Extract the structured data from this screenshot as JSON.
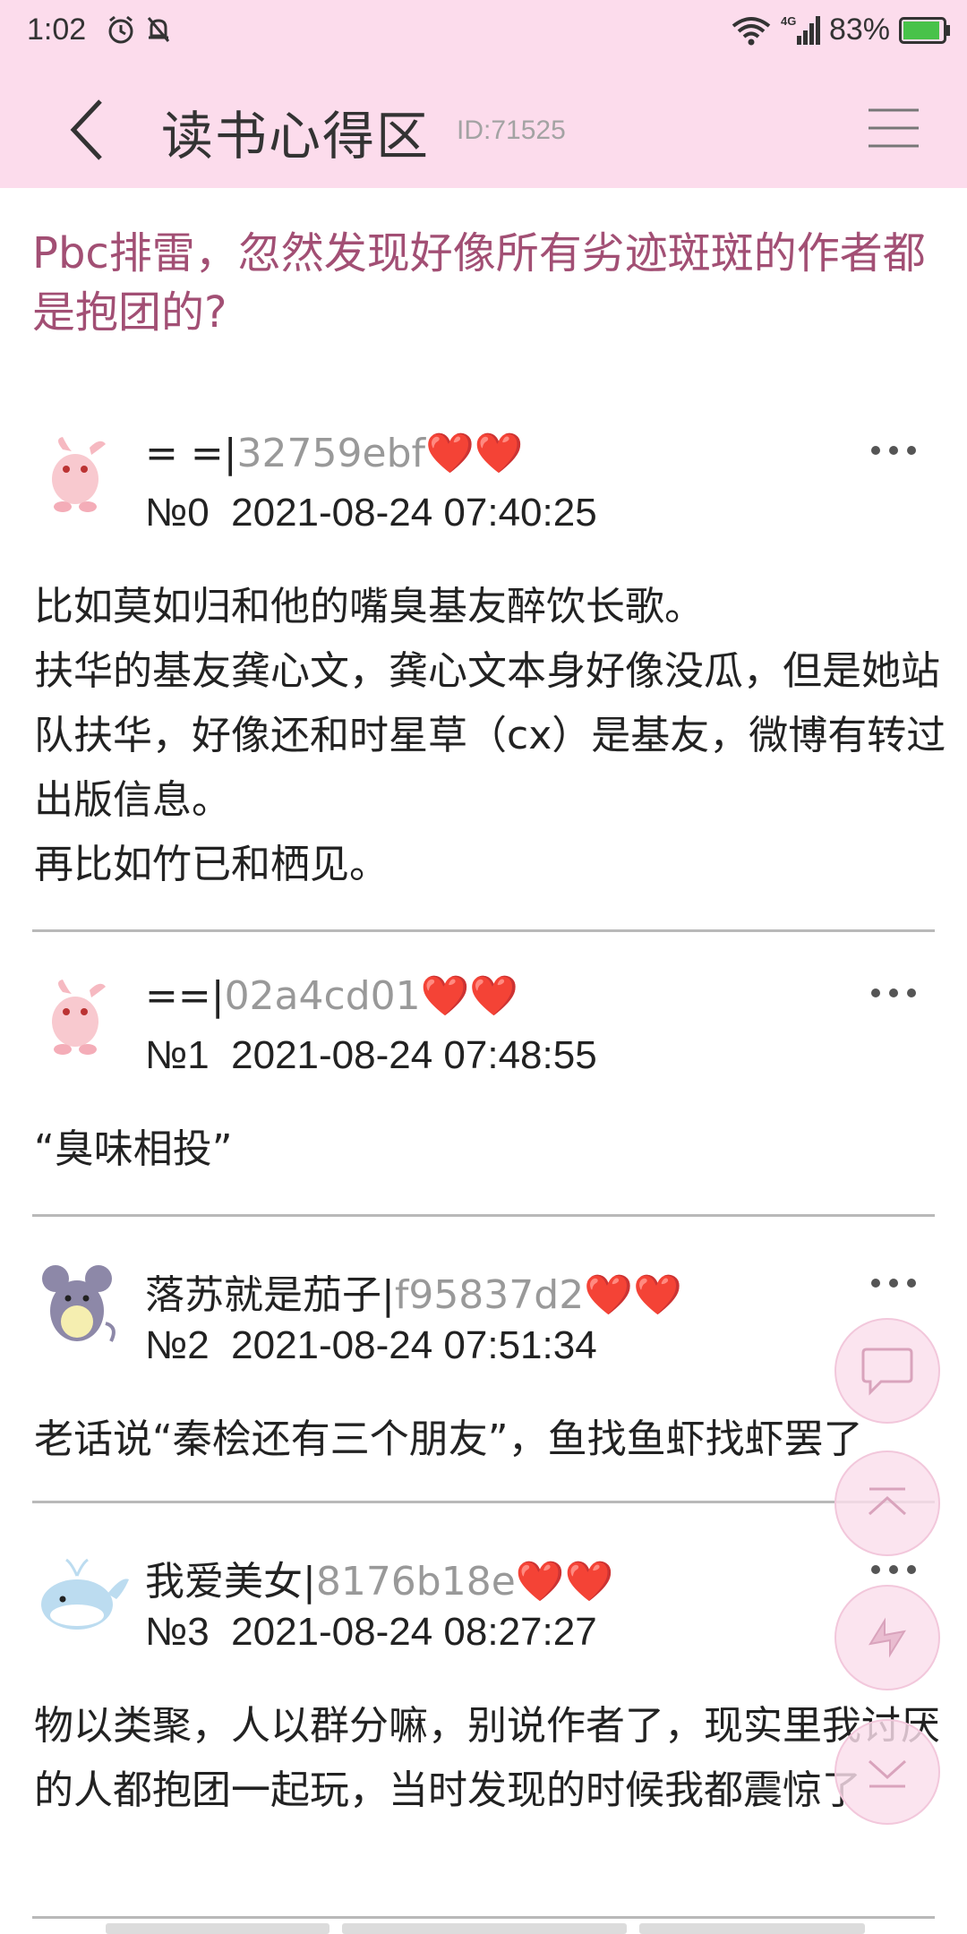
{
  "status_bar": {
    "time": "1:02",
    "network": "4G",
    "battery": "83%",
    "icons": [
      "alarm-icon",
      "mute-icon",
      "wifi-icon",
      "signal-icon",
      "battery-icon"
    ]
  },
  "header": {
    "title": "读书心得区",
    "id_label": "ID:71525",
    "back_icon": "chevron-left-icon",
    "menu_icon": "hamburger-menu-icon"
  },
  "thread": {
    "title": "Pbc排雷，忽然发现好像所有劣迹斑斑的作者都是抱团的?"
  },
  "posts": [
    {
      "user_name": "= =|",
      "user_hash": "32759ebf",
      "hearts": "❤️❤️",
      "floor": "№0",
      "timestamp": "2021-08-24 07:40:25",
      "body": "比如莫如归和他的嘴臭基友醉饮长歌。\n扶华的基友龚心文，龚心文本身好像没瓜，但是她站队扶华，好像还和时星草（cx）是基友，微博有转过出版信息。\n再比如竹已和栖见。",
      "avatar": "pink-creature-avatar"
    },
    {
      "user_name": "==|",
      "user_hash": "02a4cd01",
      "hearts": "❤️❤️",
      "floor": "№1",
      "timestamp": "2021-08-24 07:48:55",
      "body": "“臭味相投”",
      "avatar": "pink-creature-avatar"
    },
    {
      "user_name": "落苏就是茄子|",
      "user_hash": "f95837d2",
      "hearts": "❤️❤️",
      "floor": "№2",
      "timestamp": "2021-08-24 07:51:34",
      "body": "老话说“秦桧还有三个朋友”，鱼找鱼虾找虾罢了",
      "avatar": "purple-mouse-avatar"
    },
    {
      "user_name": "我爱美女|",
      "user_hash": "8176b18e",
      "hearts": "❤️❤️",
      "floor": "№3",
      "timestamp": "2021-08-24 08:27:27",
      "body": "物以类聚，人以群分嘛，别说作者了，现实里我讨厌的人都抱团一起玩，当时发现的时候我都震惊了",
      "avatar": "blue-whale-avatar"
    }
  ],
  "floating_buttons": [
    "comment-icon",
    "scroll-top-icon",
    "refresh-icon",
    "scroll-bottom-icon"
  ],
  "colors": {
    "header_bg": "#fcdcec",
    "thread_title": "#a24f74",
    "hash": "#999999",
    "hearts": "#e81224"
  }
}
